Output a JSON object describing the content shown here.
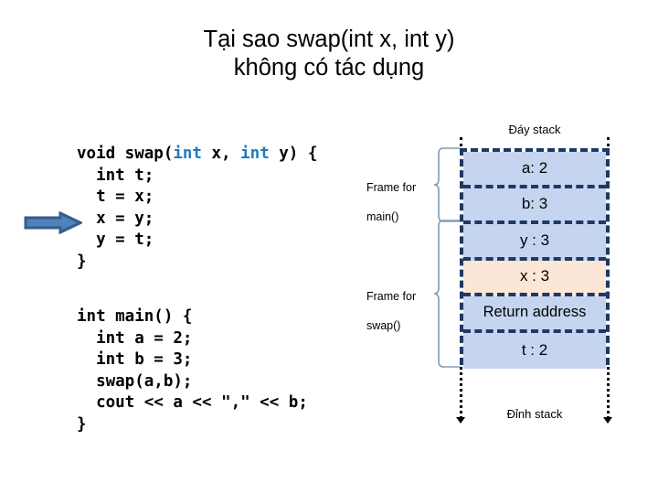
{
  "slide": {
    "title_lines": [
      "Tại sao swap(int x, int y)",
      "không có tác dụng"
    ]
  },
  "code_swap": {
    "name": "swap-function-code",
    "lines": [
      {
        "segments": [
          {
            "t": "void swap(",
            "k": false
          },
          {
            "t": "int",
            "k": true
          },
          {
            "t": " x, ",
            "k": false
          },
          {
            "t": "int",
            "k": true
          },
          {
            "t": " y) {",
            "k": false
          }
        ]
      },
      {
        "segments": [
          {
            "t": "  int t;",
            "k": false
          }
        ]
      },
      {
        "segments": [
          {
            "t": "  t = x;",
            "k": false
          }
        ]
      },
      {
        "segments": [
          {
            "t": "  x = y;",
            "k": false
          }
        ]
      },
      {
        "segments": [
          {
            "t": "  y = t;",
            "k": false
          }
        ]
      },
      {
        "segments": [
          {
            "t": "}",
            "k": false
          }
        ]
      }
    ]
  },
  "code_main": {
    "name": "main-function-code",
    "lines": [
      {
        "segments": [
          {
            "t": "int main() {",
            "k": false
          }
        ]
      },
      {
        "segments": [
          {
            "t": "  int a = 2;",
            "k": false
          }
        ]
      },
      {
        "segments": [
          {
            "t": "  int b = 3;",
            "k": false
          }
        ]
      },
      {
        "segments": [
          {
            "t": "  swap(a,b);",
            "k": false
          }
        ]
      },
      {
        "segments": [
          {
            "t": "  cout << a << \",\" << b;",
            "k": false
          }
        ]
      },
      {
        "segments": [
          {
            "t": "}",
            "k": false
          }
        ]
      }
    ]
  },
  "pointer": {
    "label": "current-execution-arrow",
    "points_at_line": "  x = y;",
    "fill_color": "#4f81bd",
    "border_color": "#385d8a"
  },
  "frames": {
    "main": {
      "line1": "Frame for",
      "line2": "main()"
    },
    "swap": {
      "line1": "Frame for",
      "line2": "swap()"
    }
  },
  "stack": {
    "caption_top": "Đáy stack",
    "caption_bottom": "Đỉnh stack",
    "cell_color": "#c5d5ef",
    "highlight_color": "#fce6d5",
    "border_color": "#1f3864",
    "rows": [
      {
        "label": "a: 2",
        "highlight": false
      },
      {
        "label": "b: 3",
        "highlight": false
      },
      {
        "label": "y : 3",
        "highlight": false
      },
      {
        "label": "x : 3",
        "highlight": true
      },
      {
        "label": "Return address",
        "highlight": false
      },
      {
        "label": "t : 2",
        "highlight": false
      }
    ]
  }
}
